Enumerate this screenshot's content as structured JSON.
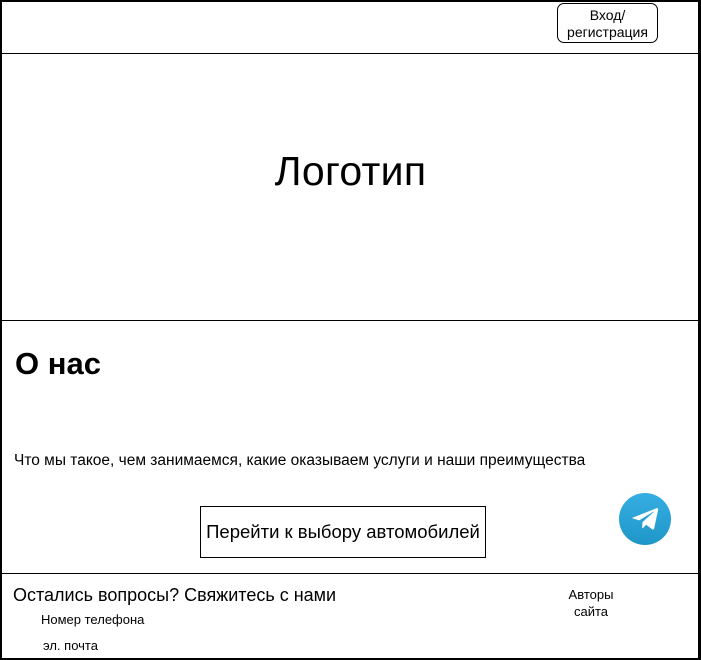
{
  "header": {
    "login_label": "Вход/\nрегистрация"
  },
  "hero": {
    "logo_text": "Логотип"
  },
  "about": {
    "title": "О нас",
    "description": "Что мы такое, чем занимаемся, какие оказываем услуги и наши преимущества",
    "cars_button_label": "Перейти к выбору автомобилей"
  },
  "telegram": {
    "icon": "telegram-icon",
    "color": "#2aa3dc"
  },
  "footer": {
    "contact_title": "Остались вопросы? Свяжитесь с нами",
    "phone_label": "Номер телефона",
    "email_label": "эл. почта",
    "authors_label": "Авторы\nсайта"
  }
}
